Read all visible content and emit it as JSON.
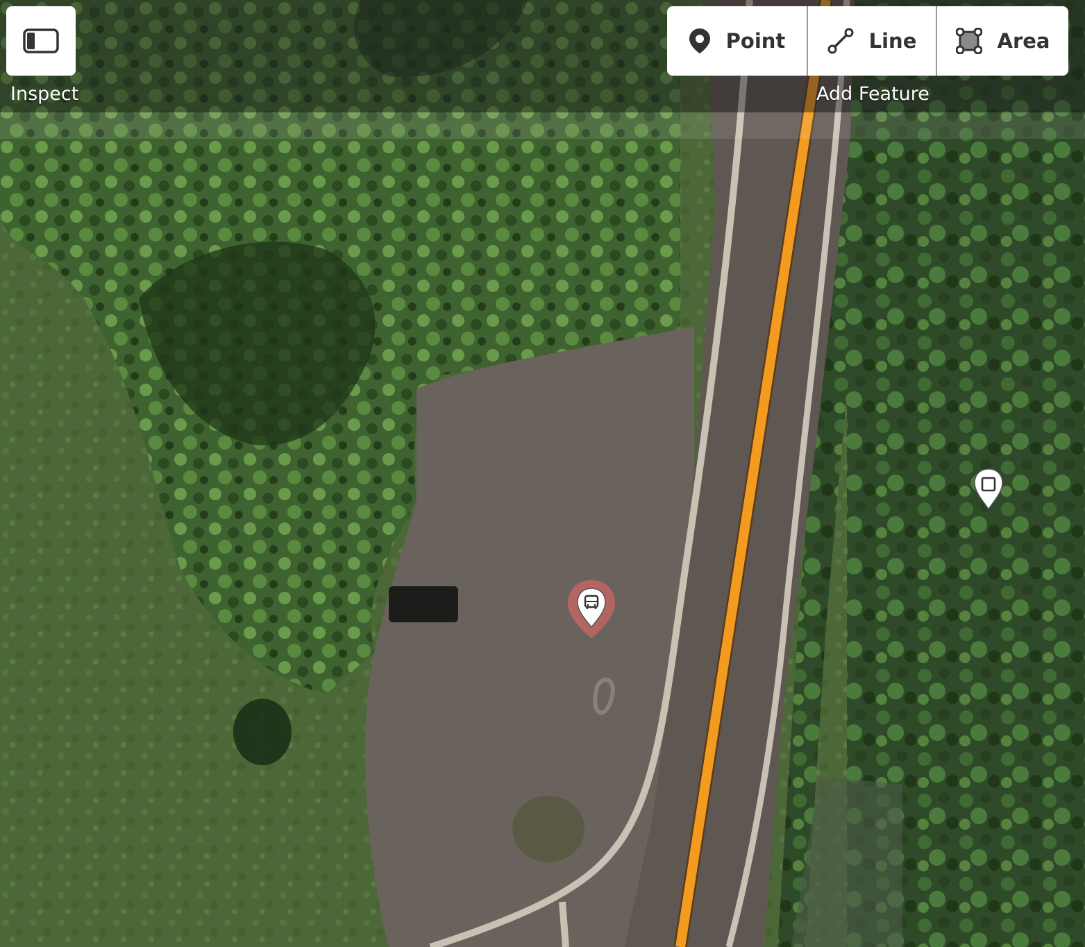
{
  "toolbar": {
    "inspect": {
      "label": "Inspect",
      "icon": "sidebar-toggle-icon"
    },
    "add_feature": {
      "label": "Add Feature",
      "buttons": [
        {
          "label": "Point",
          "icon": "map-pin-icon"
        },
        {
          "label": "Line",
          "icon": "line-icon"
        },
        {
          "label": "Area",
          "icon": "area-icon"
        }
      ]
    }
  },
  "map": {
    "markers": [
      {
        "type": "bus-stop",
        "icon": "bus-icon",
        "selected": true
      },
      {
        "type": "area",
        "icon": "square-icon",
        "selected": false
      }
    ],
    "colors": {
      "highlighted_road": "#f29b1f",
      "selected_marker_halo": "#c0675f",
      "grass": "#4f6a3a",
      "forest": "#2f4a27",
      "pavement": "#6e6660"
    }
  }
}
